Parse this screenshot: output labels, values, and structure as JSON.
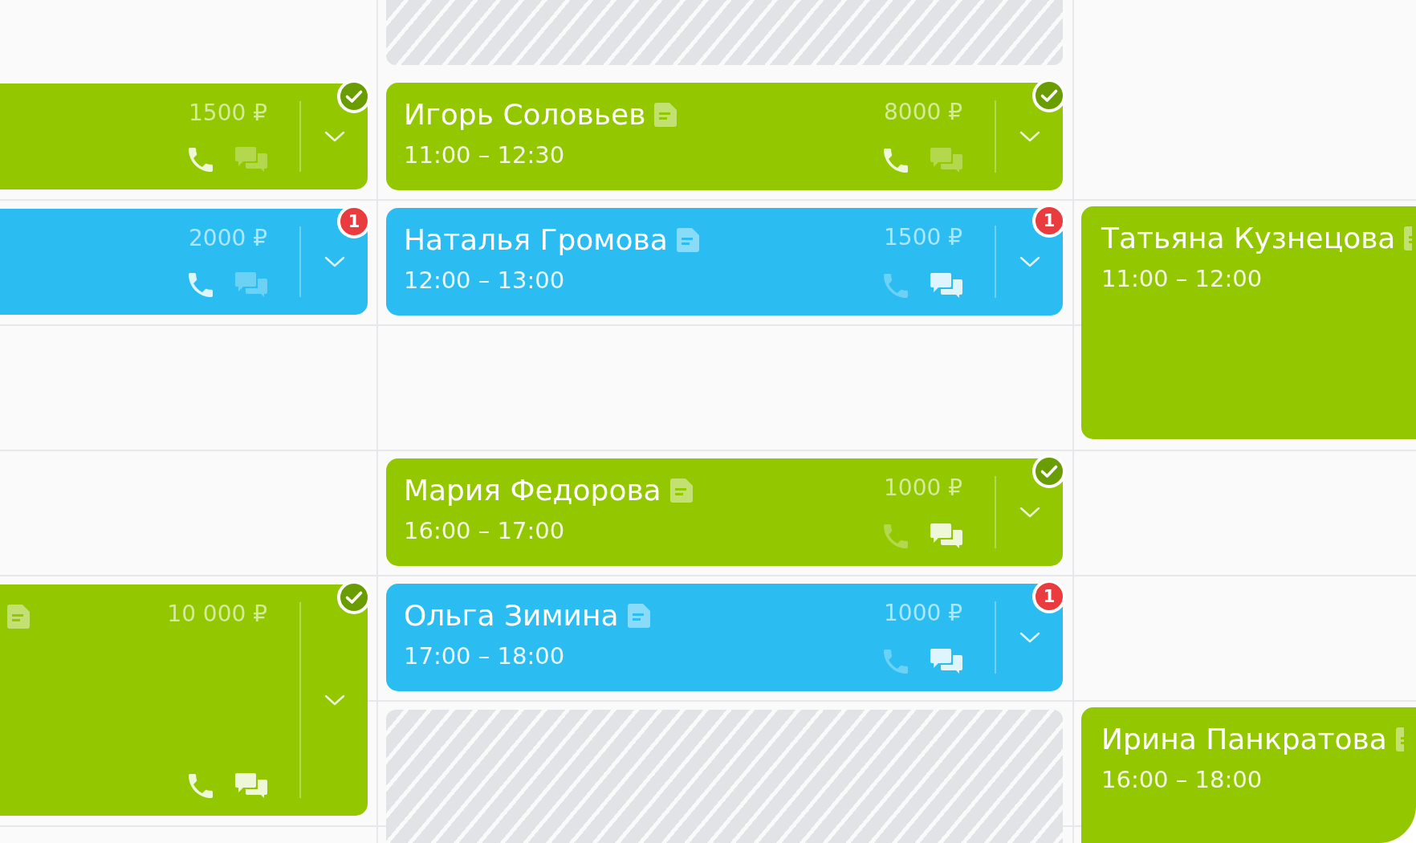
{
  "calendar": {
    "columns": [
      {
        "items": [
          {
            "kind": "appointment",
            "color": "#93c700",
            "price": "1500 ₽",
            "call_active": true,
            "chat_active": false,
            "badge": {
              "kind": "check"
            }
          },
          {
            "kind": "appointment",
            "color": "#2bbdf1",
            "price": "2000 ₽",
            "call_active": true,
            "chat_active": false,
            "badge": {
              "kind": "count",
              "text": "1"
            }
          },
          {
            "kind": "appointment",
            "color": "#93c700",
            "note": true,
            "price": "10 000 ₽",
            "call_active": true,
            "chat_active": true,
            "badge": {
              "kind": "check"
            }
          }
        ]
      },
      {
        "items": [
          {
            "kind": "blocked"
          },
          {
            "kind": "appointment",
            "color": "#93c700",
            "name": "Игорь Соловьев",
            "note": true,
            "time": "11:00 – 12:30",
            "price": "8000 ₽",
            "call_active": true,
            "chat_active": false,
            "badge": {
              "kind": "check"
            }
          },
          {
            "kind": "appointment",
            "color": "#2bbdf1",
            "name": "Наталья Громова",
            "note": true,
            "time": "12:00 – 13:00",
            "price": "1500 ₽",
            "call_active": false,
            "chat_active": true,
            "badge": {
              "kind": "count",
              "text": "1"
            }
          },
          {
            "kind": "appointment",
            "color": "#93c700",
            "name": "Мария Федорова",
            "note": true,
            "time": "16:00 – 17:00",
            "price": "1000 ₽",
            "call_active": false,
            "chat_active": true,
            "badge": {
              "kind": "check"
            }
          },
          {
            "kind": "appointment",
            "color": "#2bbdf1",
            "name": "Ольга Зимина",
            "note": true,
            "time": "17:00 – 18:00",
            "price": "1000 ₽",
            "call_active": false,
            "chat_active": true,
            "badge": {
              "kind": "count",
              "text": "1"
            }
          },
          {
            "kind": "blocked"
          }
        ]
      },
      {
        "items": [
          {
            "kind": "appointment",
            "color": "#93c700",
            "name": "Татьяна Кузнецова",
            "note": true,
            "time": "11:00 – 12:00"
          },
          {
            "kind": "appointment",
            "color": "#93c700",
            "name": "Ирина Панкратова",
            "note": true,
            "time": "16:00 – 18:00"
          }
        ]
      }
    ]
  }
}
